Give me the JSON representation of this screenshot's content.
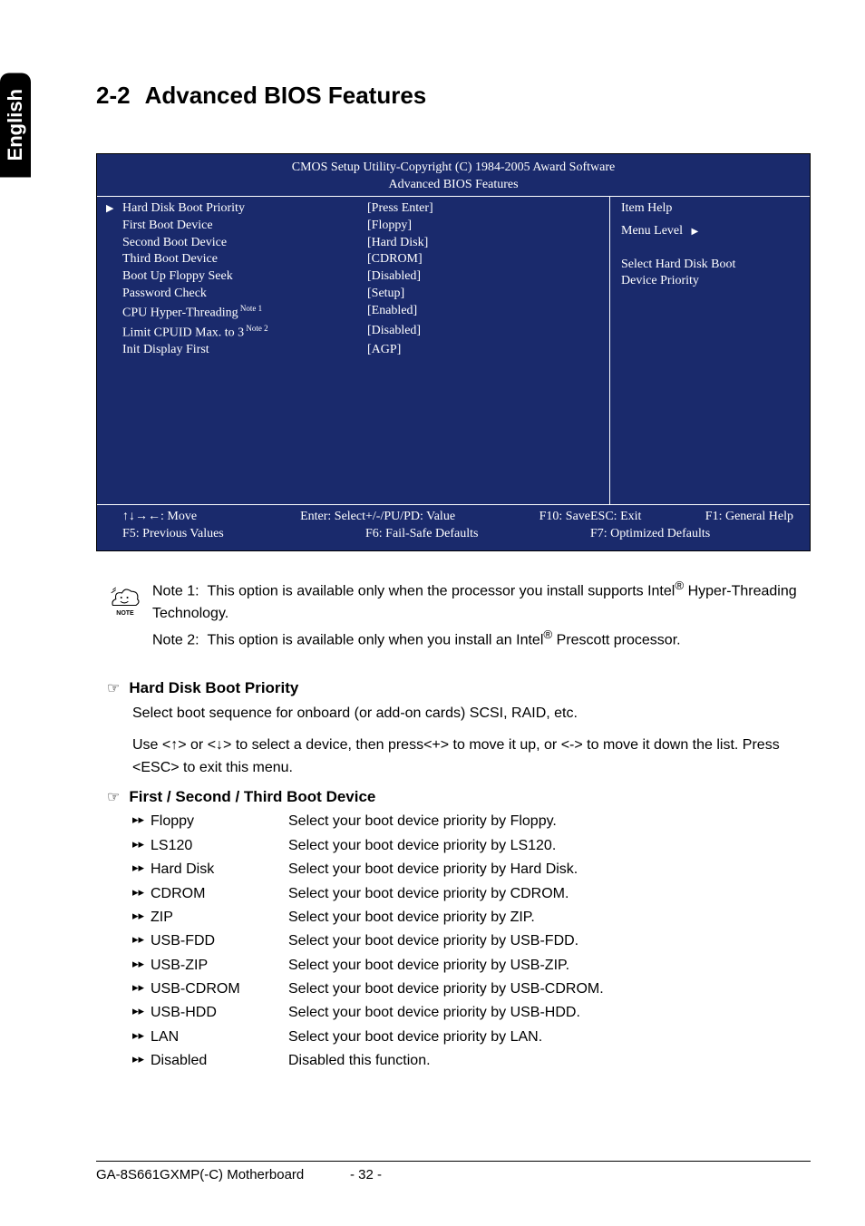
{
  "side_tab": "English",
  "section_number": "2-2",
  "section_title": "Advanced BIOS Features",
  "bios": {
    "header_line1": "CMOS Setup Utility-Copyright (C) 1984-2005 Award Software",
    "header_line2": "Advanced BIOS Features",
    "settings": [
      {
        "label": "Hard Disk Boot Priority",
        "value": "[Press Enter]"
      },
      {
        "label": "First Boot Device",
        "value": "[Floppy]"
      },
      {
        "label": "Second Boot Device",
        "value": "[Hard Disk]"
      },
      {
        "label": "Third Boot Device",
        "value": "[CDROM]"
      },
      {
        "label": "Boot Up Floppy Seek",
        "value": "[Disabled]"
      },
      {
        "label": "Password Check",
        "value": "[Setup]"
      },
      {
        "label": "CPU Hyper-Threading",
        "note": "Note 1",
        "value": "[Enabled]"
      },
      {
        "label": "Limit CPUID Max. to 3",
        "note": "Note 2",
        "value": "[Disabled]"
      },
      {
        "label": "Init Display First",
        "value": "[AGP]"
      }
    ],
    "help": {
      "title": "Item Help",
      "menu_level": "Menu Level",
      "desc_line1": "Select Hard Disk Boot",
      "desc_line2": "Device Priority"
    },
    "footer": {
      "move": "↑↓→←: Move",
      "select": "Enter: Select",
      "prev": "F5: Previous Values",
      "value": "+/-/PU/PD: Value",
      "save": "F10: Save",
      "failsafe": "F6: Fail-Safe Defaults",
      "exit": "ESC: Exit",
      "help": "F1: General Help",
      "optimized": "F7: Optimized Defaults"
    }
  },
  "notes": {
    "icon_label": "NOTE",
    "note1_label": "Note 1:",
    "note1_text_a": "This option is available only when the processor you install supports Intel",
    "note1_text_b": " Hyper-Threading Technology.",
    "note2_label": "Note 2:",
    "note2_text_a": "This option is available only when you install an Intel",
    "note2_text_b": " Prescott processor.",
    "reg": "®"
  },
  "descriptions": {
    "hd_heading": "Hard Disk Boot Priority",
    "hd_para1": "Select boot sequence for onboard (or add-on cards) SCSI, RAID, etc.",
    "hd_para2": "Use <↑> or <↓> to select a device, then press<+> to move it up, or <-> to move it down the list. Press <ESC> to exit this menu.",
    "boot_heading": "First / Second / Third Boot Device",
    "options": [
      {
        "name": "Floppy",
        "desc": "Select your boot device priority by Floppy."
      },
      {
        "name": "LS120",
        "desc": "Select your boot device priority by LS120."
      },
      {
        "name": "Hard Disk",
        "desc": "Select your boot device priority by Hard Disk."
      },
      {
        "name": "CDROM",
        "desc": "Select your boot device priority by CDROM."
      },
      {
        "name": "ZIP",
        "desc": "Select your boot device priority by ZIP."
      },
      {
        "name": "USB-FDD",
        "desc": "Select your boot device priority by USB-FDD."
      },
      {
        "name": "USB-ZIP",
        "desc": "Select your boot device priority by USB-ZIP."
      },
      {
        "name": "USB-CDROM",
        "desc": "Select your boot device priority by USB-CDROM."
      },
      {
        "name": "USB-HDD",
        "desc": "Select your boot device priority by USB-HDD."
      },
      {
        "name": "LAN",
        "desc": "Select your boot device priority by LAN."
      },
      {
        "name": "Disabled",
        "desc": "Disabled this function."
      }
    ]
  },
  "footer_left": "GA-8S661GXMP(-C) Motherboard",
  "footer_center": "- 32 -"
}
